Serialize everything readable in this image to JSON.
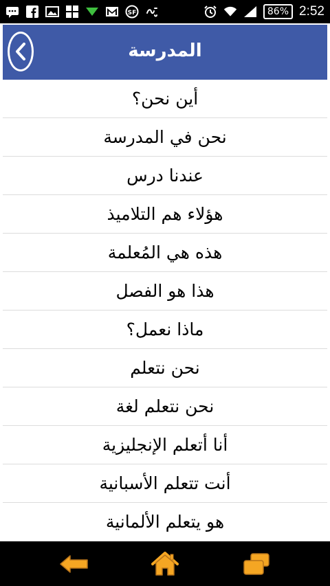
{
  "status_bar": {
    "left_icons": [
      "chat-icon",
      "facebook-icon",
      "image-icon",
      "windows-icon",
      "download-icon",
      "gmail-icon",
      "sf-icon",
      "arabic-app-icon"
    ],
    "right_icons": [
      "alarm-icon",
      "wifi-icon",
      "signal-icon"
    ],
    "battery": "86%",
    "time": "2:52"
  },
  "header": {
    "title": "المدرسة",
    "background": "#3f5aa7",
    "back_icon": "chevron-left-icon"
  },
  "phrases": [
    "أين نحن؟",
    "نحن في المدرسة",
    "عندنا درس",
    "هؤلاء هم التلاميذ",
    "هذه هي المُعلمة",
    "هذا هو الفصل",
    "ماذا نعمل؟",
    "نحن نتعلم",
    "نحن نتعلم لغة",
    "أنا أتعلم الإنجليزية",
    "أنت تتعلم الأسبانية",
    "هو يتعلم الألمانية"
  ],
  "bottom_nav": {
    "items": [
      "back-arrow-icon",
      "home-icon",
      "recent-apps-icon"
    ],
    "accent": "#f5a623"
  }
}
